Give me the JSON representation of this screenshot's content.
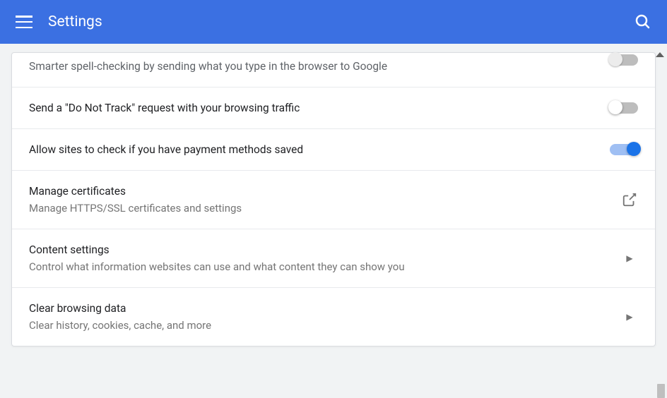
{
  "header": {
    "title": "Settings"
  },
  "rows": {
    "spellcheck": {
      "subtitle": "Smarter spell-checking by sending what you type in the browser to Google"
    },
    "dnt": {
      "title": "Send a \"Do Not Track\" request with your browsing traffic"
    },
    "payment": {
      "title": "Allow sites to check if you have payment methods saved"
    },
    "certs": {
      "title": "Manage certificates",
      "subtitle": "Manage HTTPS/SSL certificates and settings"
    },
    "content": {
      "title": "Content settings",
      "subtitle": "Control what information websites can use and what content they can show you"
    },
    "clear": {
      "title": "Clear browsing data",
      "subtitle": "Clear history, cookies, cache, and more"
    }
  }
}
